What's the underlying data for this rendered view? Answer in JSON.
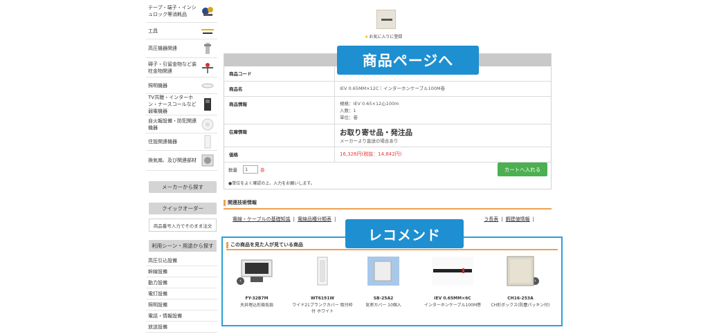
{
  "sidebar": {
    "categories": [
      {
        "label": "テープ・端子・インシュロック等消耗品",
        "icon": "consumables-thumbnail"
      },
      {
        "label": "工具",
        "icon": "tools-thumbnail"
      },
      {
        "label": "高圧機器関連",
        "icon": "high-voltage-thumbnail"
      },
      {
        "label": "碍子・引留金物など装柱金物関連",
        "icon": "insulator-thumbnail"
      },
      {
        "label": "照明機器",
        "icon": "lighting-thumbnail"
      },
      {
        "label": "TV共聴・インターホン・ナースコールなど弱電機器",
        "icon": "intercom-thumbnail"
      },
      {
        "label": "自火報設備・防犯関連機器",
        "icon": "fire-alarm-thumbnail"
      },
      {
        "label": "住設関連機器",
        "icon": "housing-thumbnail"
      },
      {
        "label": "換気扇、及び関連部材",
        "icon": "fan-thumbnail"
      }
    ],
    "maker_search_label": "メーカーから探す",
    "quick_order_label": "クイックオーダー",
    "quick_order_hint": "商品番号入力でそのまま注文",
    "scene_search_label": "利用シーン・用途から探す",
    "scenes": [
      "高圧引込設備",
      "幹線設備",
      "動力設備",
      "電灯設備",
      "照明設備",
      "電話・情報設備",
      "放送設備"
    ]
  },
  "product": {
    "favorite_label": "お気に入りに登録",
    "rows": {
      "code_label": "商品コード",
      "name_label": "商品名",
      "name_value": "IEV 0.65MM×12C｜インターホンケーブル100M巻",
      "info_label": "商品情報",
      "info_lines": [
        "規格：IEV 0.65×12心100m",
        "入数：1",
        "単位：巻"
      ],
      "stock_label": "在庫情報",
      "stock_main": "お取り寄せ品・発注品",
      "stock_sub": "メーカーより直送の場合あり",
      "price_label": "価格",
      "price_value": "16,326円(税抜：14,842円)"
    },
    "qty_label": "数量",
    "qty_value": "1",
    "qty_unit": "巻",
    "qty_note": "●単位をよく確認の上、入力をお願いします。",
    "cart_button": "カートへ入れる"
  },
  "tech_info": {
    "title": "関連技術情報",
    "links": [
      "電線・ケーブルの基礎知識",
      "電線品種分類表",
      "う長表",
      "鋼建値情報"
    ]
  },
  "recommend": {
    "title": "この商品を見た人が見ている商品",
    "items": [
      {
        "code": "FY-32B7M",
        "name": "天井埋込形換気扇",
        "icon": "ceiling-fan-image"
      },
      {
        "code": "WT6191W",
        "name": "ワイド21ブランクカバー 取付枠付 ホワイト",
        "icon": "switch-plate-image"
      },
      {
        "code": "SB-25A2",
        "name": "気密カバー 10個入",
        "icon": "airtight-cover-image"
      },
      {
        "code": "IEV 0.65MM×6C",
        "name": "インターホンケーブル100M巻",
        "icon": "cable-image"
      },
      {
        "code": "CH16-253A",
        "name": "CH形ボックス(防塵パッキン付)",
        "icon": "box-image"
      }
    ]
  },
  "callouts": {
    "product_page": "商品ページへ",
    "recommend": "レコメンド"
  },
  "colors": {
    "callout": "#1e8fd0",
    "cart_button": "#4caf50",
    "price": "#e53935",
    "accent_line": "#f0a050"
  }
}
